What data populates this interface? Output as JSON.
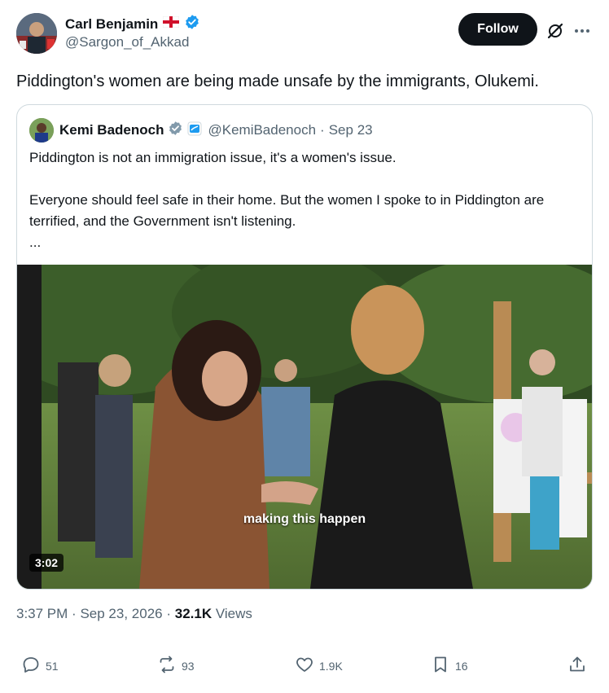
{
  "author": {
    "name": "Carl Benjamin",
    "handle": "@Sargon_of_Akkad",
    "flag": "england-flag",
    "verified_color": "#1d9bf0"
  },
  "header": {
    "follow_label": "Follow",
    "grok_icon": "grok-icon",
    "more_icon": "more-icon"
  },
  "tweet": {
    "text": "Piddington's women are being made unsafe by the immigrants, Olukemi."
  },
  "quoted": {
    "name": "Kemi Badenoch",
    "handle": "@KemiBadenoch",
    "sep": "·",
    "date": "Sep 23",
    "line1": "Piddington is not an immigration issue, it's a women's issue.",
    "line2": "Everyone should feel safe in their home. But the women I spoke to in Piddington are terrified, and the Government isn't listening.",
    "ellipsis": "...",
    "video": {
      "caption": "making this happen",
      "duration": "3:02"
    }
  },
  "meta": {
    "time": "3:37 PM",
    "sep1": "·",
    "date": "Sep 23, 2026",
    "sep2": "·",
    "views_count": "32.1K",
    "views_label": "Views"
  },
  "actions": {
    "replies": "51",
    "reposts": "93",
    "likes": "1.9K",
    "bookmarks": "16"
  }
}
